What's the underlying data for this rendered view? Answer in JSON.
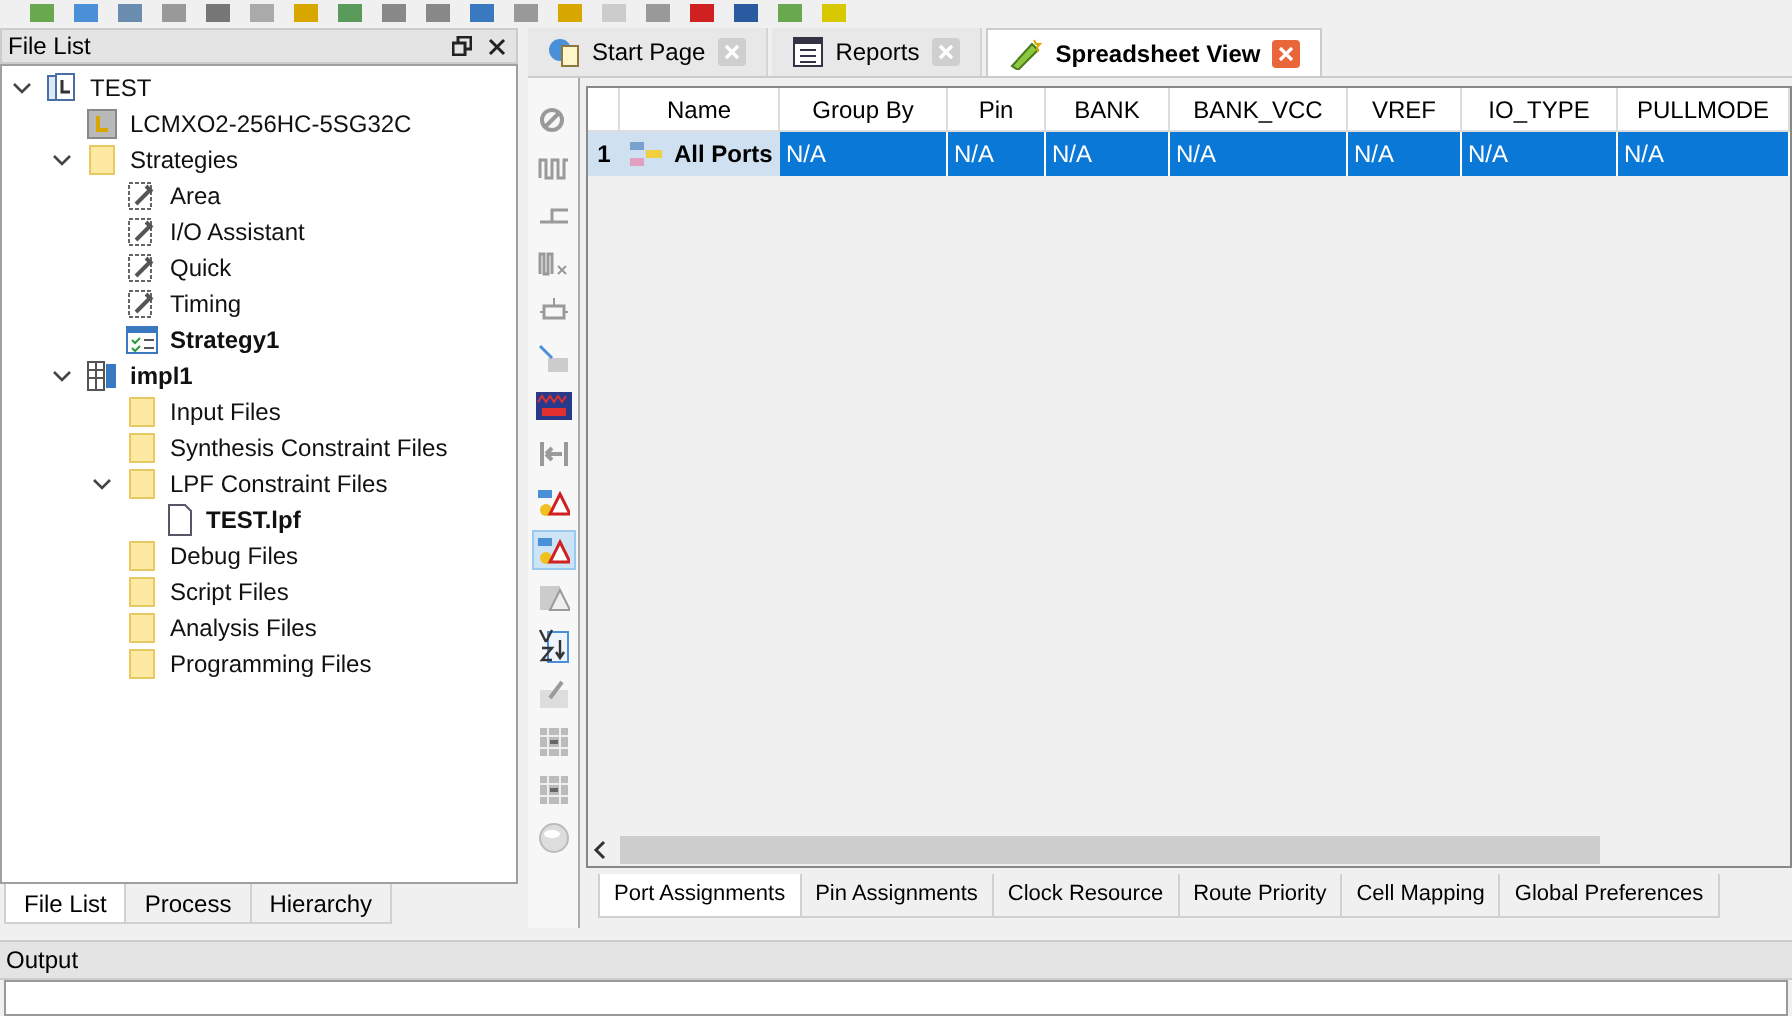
{
  "left_panel": {
    "title": "File List",
    "tree": [
      {
        "label": "TEST",
        "kind": "project",
        "bold": false,
        "expanded": true,
        "children": [
          {
            "label": "LCMXO2-256HC-5SG32C",
            "kind": "device",
            "bold": false
          },
          {
            "label": "Strategies",
            "kind": "folder",
            "bold": false,
            "expanded": true,
            "children": [
              {
                "label": "Area",
                "kind": "strategy",
                "bold": false
              },
              {
                "label": "I/O Assistant",
                "kind": "strategy",
                "bold": false
              },
              {
                "label": "Quick",
                "kind": "strategy",
                "bold": false
              },
              {
                "label": "Timing",
                "kind": "strategy",
                "bold": false
              },
              {
                "label": "Strategy1",
                "kind": "active-strategy",
                "bold": true
              }
            ]
          },
          {
            "label": "impl1",
            "kind": "implementation",
            "bold": true,
            "expanded": true,
            "children": [
              {
                "label": "Input Files",
                "kind": "folder",
                "bold": false
              },
              {
                "label": "Synthesis Constraint Files",
                "kind": "folder",
                "bold": false
              },
              {
                "label": "LPF Constraint Files",
                "kind": "folder",
                "bold": false,
                "expanded": true,
                "children": [
                  {
                    "label": "TEST.lpf",
                    "kind": "file",
                    "bold": true
                  }
                ]
              },
              {
                "label": "Debug Files",
                "kind": "folder",
                "bold": false
              },
              {
                "label": "Script Files",
                "kind": "folder",
                "bold": false
              },
              {
                "label": "Analysis Files",
                "kind": "folder",
                "bold": false
              },
              {
                "label": "Programming Files",
                "kind": "folder",
                "bold": false
              }
            ]
          }
        ]
      }
    ],
    "tabs": [
      {
        "label": "File List",
        "selected": true
      },
      {
        "label": "Process",
        "selected": false
      },
      {
        "label": "Hierarchy",
        "selected": false
      }
    ]
  },
  "doc_tabs": [
    {
      "label": "Start Page",
      "kind": "globe",
      "selected": false
    },
    {
      "label": "Reports",
      "kind": "report",
      "selected": false
    },
    {
      "label": "Spreadsheet View",
      "kind": "spreadsheet",
      "selected": true
    }
  ],
  "side_tools": [
    {
      "kind": "noclock",
      "selected": false
    },
    {
      "kind": "wave",
      "selected": false
    },
    {
      "kind": "branch",
      "selected": false
    },
    {
      "kind": "wave2",
      "selected": false
    },
    {
      "kind": "chip",
      "selected": false
    },
    {
      "kind": "move",
      "selected": false
    },
    {
      "kind": "vref",
      "selected": false
    },
    {
      "kind": "bracket",
      "selected": false
    },
    {
      "kind": "warning",
      "selected": false
    },
    {
      "kind": "warning",
      "selected": true
    },
    {
      "kind": "chipwarn",
      "selected": false
    },
    {
      "kind": "sort",
      "selected": false
    },
    {
      "kind": "edit",
      "selected": false
    },
    {
      "kind": "grid",
      "selected": false
    },
    {
      "kind": "grid",
      "selected": false
    },
    {
      "kind": "sphere",
      "selected": false
    }
  ],
  "table": {
    "columns": [
      "Name",
      "Group By",
      "Pin",
      "BANK",
      "BANK_VCC",
      "VREF",
      "IO_TYPE",
      "PULLMODE"
    ],
    "rows": [
      {
        "number": "1",
        "selected": true,
        "cells": [
          "All Ports",
          "N/A",
          "N/A",
          "N/A",
          "N/A",
          "N/A",
          "N/A",
          "N/A"
        ]
      }
    ]
  },
  "sheet_tabs": [
    {
      "label": "Port Assignments",
      "selected": true
    },
    {
      "label": "Pin Assignments",
      "selected": false
    },
    {
      "label": "Clock Resource",
      "selected": false
    },
    {
      "label": "Route Priority",
      "selected": false
    },
    {
      "label": "Cell Mapping",
      "selected": false
    },
    {
      "label": "Global Preferences",
      "selected": false
    }
  ],
  "output": {
    "title": "Output"
  }
}
